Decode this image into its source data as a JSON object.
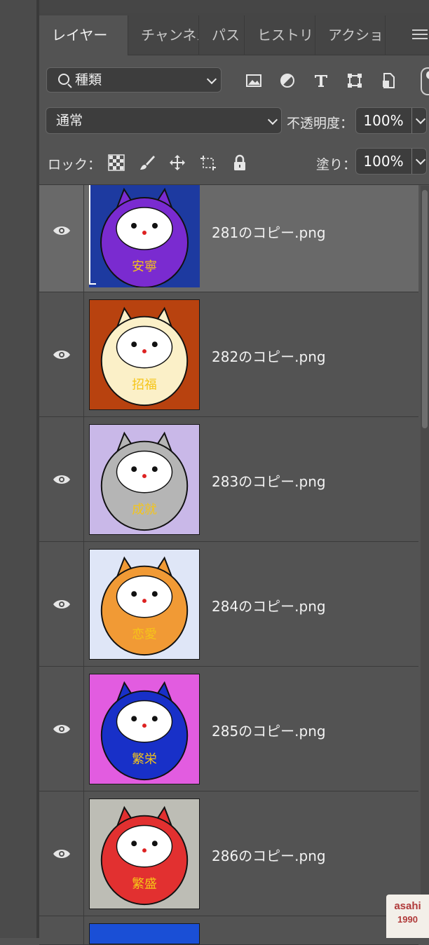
{
  "tabs": [
    {
      "label": "レイヤー",
      "active": true
    },
    {
      "label": "チャンネル",
      "active": false
    },
    {
      "label": "パス",
      "active": false
    },
    {
      "label": "ヒストリー",
      "active": false
    },
    {
      "label": "アクション",
      "active": false
    }
  ],
  "filter": {
    "kind_label": "種類"
  },
  "blend": {
    "mode": "通常",
    "opacity_label": "不透明度：",
    "opacity_value": "100%"
  },
  "lock": {
    "label": "ロック：",
    "fill_label": "塗り：",
    "fill_value": "100%"
  },
  "layers": [
    {
      "name": "281のコピー.png",
      "selected": true,
      "bg": "#1d3aa0",
      "body": "#7a2bd0",
      "text": "安寧"
    },
    {
      "name": "282のコピー.png",
      "selected": false,
      "bg": "#b8420f",
      "body": "#fbf0c8",
      "text": "招福"
    },
    {
      "name": "283のコピー.png",
      "selected": false,
      "bg": "#c9b8e8",
      "body": "#b5b5b5",
      "text": "成就"
    },
    {
      "name": "284のコピー.png",
      "selected": false,
      "bg": "#dfe6f7",
      "body": "#f19a35",
      "text": "恋愛"
    },
    {
      "name": "285のコピー.png",
      "selected": false,
      "bg": "#e25ce0",
      "body": "#1830c8",
      "text": "繁栄"
    },
    {
      "name": "286のコピー.png",
      "selected": false,
      "bg": "#bdbdb5",
      "body": "#e23030",
      "text": "繁盛"
    }
  ],
  "watermark": {
    "line1": "asahi",
    "line2": "1990"
  }
}
